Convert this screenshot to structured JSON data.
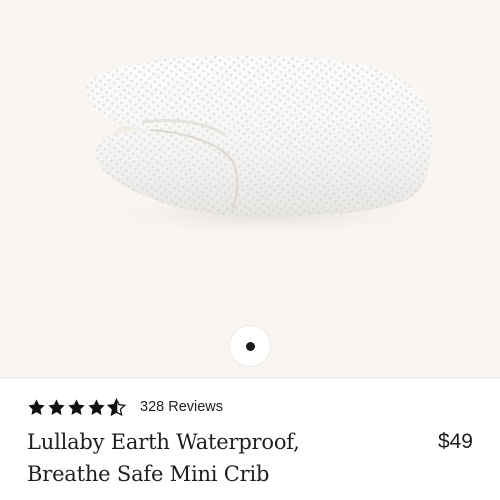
{
  "product": {
    "image": {
      "icon": "folded-mesh-crib-sheet-image"
    },
    "carousel": {
      "active_index": 1,
      "total": 1
    },
    "rating": {
      "value": 4.5,
      "max": 5
    },
    "reviews_label": "328 Reviews",
    "title_lines": [
      "Lullaby Earth Waterproof,",
      "Breathe Safe Mini Crib"
    ],
    "price": "$49"
  },
  "colors": {
    "image_background": "#f8f5f2",
    "text": "#1f1f1f",
    "star": "#111111",
    "dot": "#1a1a1a"
  }
}
